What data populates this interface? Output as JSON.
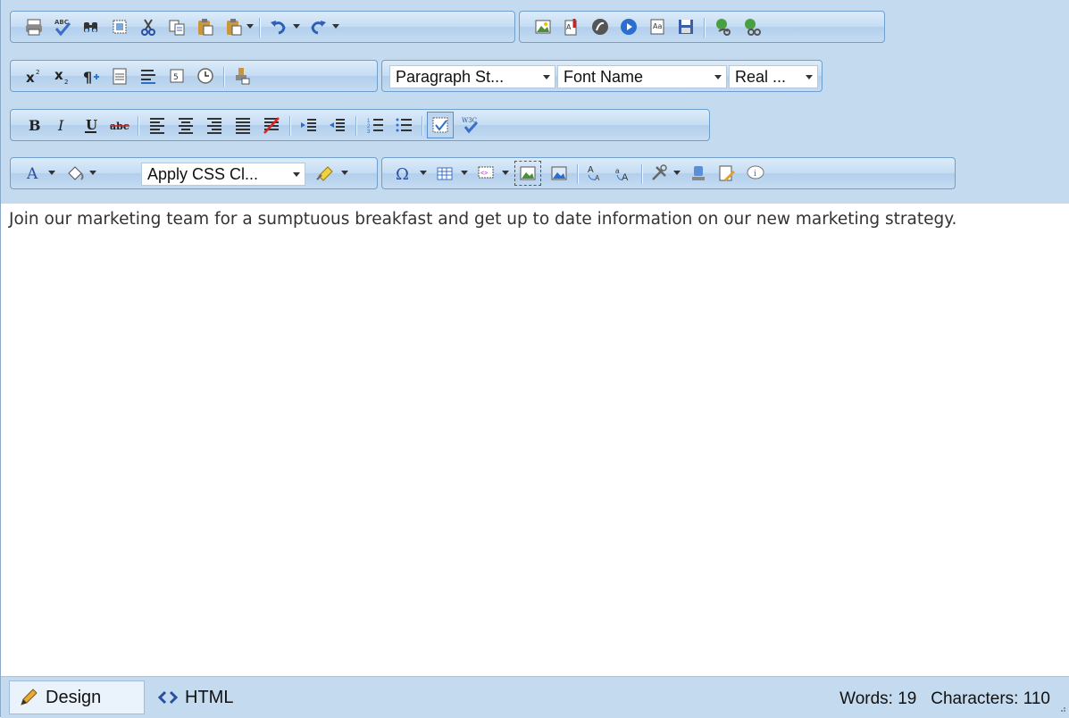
{
  "toolbar": {
    "combos": {
      "paragraph_style": "Paragraph St...",
      "font_name": "Font Name",
      "font_size": "Real ...",
      "css_class": "Apply CSS Cl..."
    },
    "row1_icons": [
      "print-icon",
      "spellcheck-icon",
      "find-replace-icon",
      "select-all-icon",
      "cut-icon",
      "copy-icon",
      "paste-icon",
      "paste-options-icon",
      "undo-icon",
      "redo-icon",
      "insert-image-icon",
      "insert-document-icon",
      "insert-flash-icon",
      "insert-media-icon",
      "template-icon",
      "save-icon",
      "hyperlink-icon",
      "remove-link-icon"
    ],
    "row2_icons": [
      "superscript-icon",
      "subscript-icon",
      "paragraph-mark-icon",
      "new-paragraph-icon",
      "align-lines-icon",
      "form-element-icon",
      "time-icon",
      "format-painter-icon"
    ],
    "row3_icons": [
      "bold-icon",
      "italic-icon",
      "underline-icon",
      "strikethrough-icon",
      "align-left-icon",
      "align-center-icon",
      "align-right-icon",
      "justify-icon",
      "clear-format-icon",
      "indent-icon",
      "outdent-icon",
      "numbered-list-icon",
      "bullet-list-icon",
      "toggle-border-icon",
      "w3c-validate-icon"
    ],
    "row4_icons": [
      "font-color-icon",
      "background-color-icon",
      "css-class-icon",
      "eraser-icon",
      "special-characters-icon",
      "insert-table-icon",
      "insert-snippet-icon",
      "image-map-icon",
      "image-manager-icon",
      "text-direction-icon",
      "upper-case-icon",
      "tools-icon",
      "xhtml-icon",
      "edit-icon",
      "about-icon"
    ]
  },
  "content": {
    "text": "Join our marketing team for a sumptuous breakfast and get up to date information on our new marketing strategy."
  },
  "footer": {
    "design_tab": "Design",
    "html_tab": "HTML",
    "words": "Words: 19",
    "characters": "Characters: 110"
  }
}
